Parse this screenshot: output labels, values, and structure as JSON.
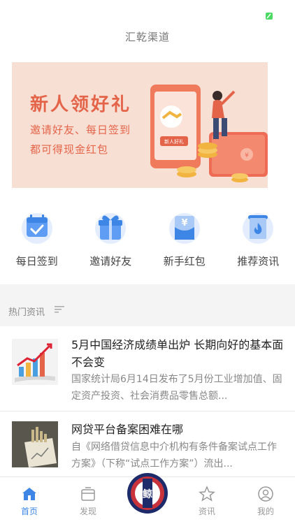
{
  "header": {
    "title": "汇乾渠道"
  },
  "status": {
    "indicator_color": "#4cd964"
  },
  "banner": {
    "title": "新人领好礼",
    "line1": "邀请好友、每日签到",
    "line2": "都可得现金红包",
    "phone_label": "新人好礼",
    "accent": "#e4644a",
    "background": "#f8dfd3"
  },
  "features": [
    {
      "label": "每日签到",
      "icon": "calendar-check-icon"
    },
    {
      "label": "邀请好友",
      "icon": "gift-box-icon"
    },
    {
      "label": "新手红包",
      "icon": "yuan-envelope-icon"
    },
    {
      "label": "推荐资讯",
      "icon": "fire-scroll-icon"
    }
  ],
  "section": {
    "title": "热门资讯",
    "icon": "list-icon"
  },
  "news": [
    {
      "title": "5月中国经济成绩单出炉 长期向好的基本面不会变",
      "summary": "国家统计局6月14日发布了5月份工业增加值、固定资产投资、社会消费品零售总额..."
    },
    {
      "title": "网贷平台备案困难在哪",
      "summary": "自《网络借贷信息中介机构有条件备案试点工作方案》（下称“试点工作方案”）流出..."
    }
  ],
  "tabs": [
    {
      "label": "首页",
      "icon": "home-icon",
      "active": true
    },
    {
      "label": "发现",
      "icon": "discover-icon",
      "active": false
    },
    {
      "label": "资讯",
      "icon": "star-icon",
      "active": false
    },
    {
      "label": "我的",
      "icon": "profile-icon",
      "active": false
    }
  ],
  "tab_center": {
    "icon": "center-logo-icon",
    "glyph": "鲸"
  },
  "colors": {
    "brand_blue": "#3d86e6",
    "logo_red": "#c8323a",
    "logo_navy": "#1d2b6b"
  }
}
